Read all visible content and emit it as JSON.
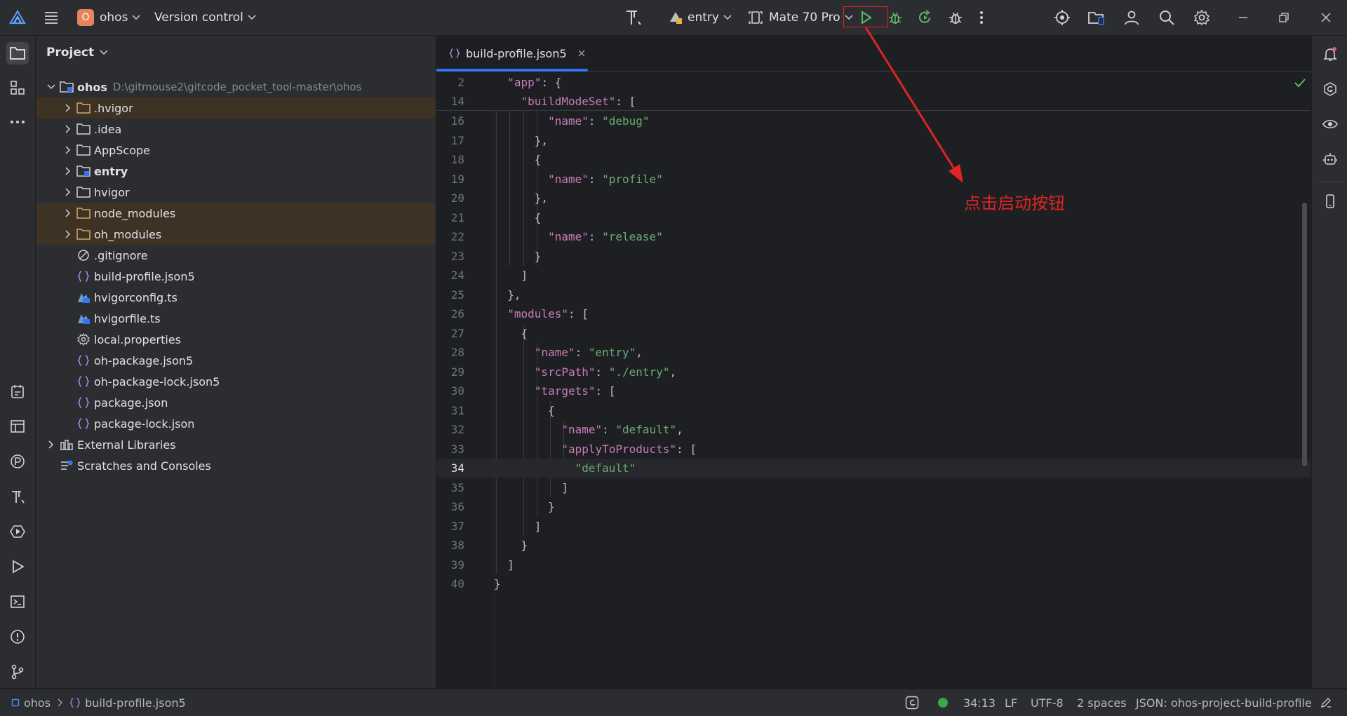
{
  "titlebar": {
    "project_initial": "O",
    "project_name": "ohos",
    "version_control": "Version control",
    "run_config": "entry",
    "device": "Mate 70 Pro"
  },
  "project_panel": {
    "title": "Project",
    "root": {
      "name": "ohos",
      "path": "D:\\gitmouse2\\gitcode_pocket_tool-master\\ohos"
    },
    "items": [
      {
        "label": ".hvigor"
      },
      {
        "label": ".idea"
      },
      {
        "label": "AppScope"
      },
      {
        "label": "entry"
      },
      {
        "label": "hvigor"
      },
      {
        "label": "node_modules"
      },
      {
        "label": "oh_modules"
      },
      {
        "label": ".gitignore"
      },
      {
        "label": "build-profile.json5"
      },
      {
        "label": "hvigorconfig.ts"
      },
      {
        "label": "hvigorfile.ts"
      },
      {
        "label": "local.properties"
      },
      {
        "label": "oh-package.json5"
      },
      {
        "label": "oh-package-lock.json5"
      },
      {
        "label": "package.json"
      },
      {
        "label": "package-lock.json"
      },
      {
        "label": "External Libraries"
      },
      {
        "label": "Scratches and Consoles"
      }
    ]
  },
  "editor": {
    "tab": "build-profile.json5",
    "sticky": [
      {
        "n": "2",
        "code": "  \"app\": {"
      },
      {
        "n": "14",
        "code": "    \"buildModeSet\": ["
      }
    ],
    "lines": [
      {
        "n": "16",
        "code": "        \"name\": \"debug\""
      },
      {
        "n": "17",
        "code": "      },"
      },
      {
        "n": "18",
        "code": "      {"
      },
      {
        "n": "19",
        "code": "        \"name\": \"profile\""
      },
      {
        "n": "20",
        "code": "      },"
      },
      {
        "n": "21",
        "code": "      {"
      },
      {
        "n": "22",
        "code": "        \"name\": \"release\""
      },
      {
        "n": "23",
        "code": "      }"
      },
      {
        "n": "24",
        "code": "    ]"
      },
      {
        "n": "25",
        "code": "  },"
      },
      {
        "n": "26",
        "code": "  \"modules\": ["
      },
      {
        "n": "27",
        "code": "    {"
      },
      {
        "n": "28",
        "code": "      \"name\": \"entry\","
      },
      {
        "n": "29",
        "code": "      \"srcPath\": \"./entry\","
      },
      {
        "n": "30",
        "code": "      \"targets\": ["
      },
      {
        "n": "31",
        "code": "        {"
      },
      {
        "n": "32",
        "code": "          \"name\": \"default\","
      },
      {
        "n": "33",
        "code": "          \"applyToProducts\": ["
      },
      {
        "n": "34",
        "code": "            \"default\""
      },
      {
        "n": "35",
        "code": "          ]"
      },
      {
        "n": "36",
        "code": "        }"
      },
      {
        "n": "37",
        "code": "      ]"
      },
      {
        "n": "38",
        "code": "    }"
      },
      {
        "n": "39",
        "code": "  ]"
      },
      {
        "n": "40",
        "code": "}"
      }
    ],
    "current_line": "34"
  },
  "statusbar": {
    "crumb_project": "ohos",
    "crumb_file": "build-profile.json5",
    "position": "34:13",
    "line_sep": "LF",
    "encoding": "UTF-8",
    "indent": "2 spaces",
    "schema": "JSON: ohos-project-build-profile"
  },
  "annotation": {
    "text": "点击启动按钮",
    "color": "#e02424"
  }
}
